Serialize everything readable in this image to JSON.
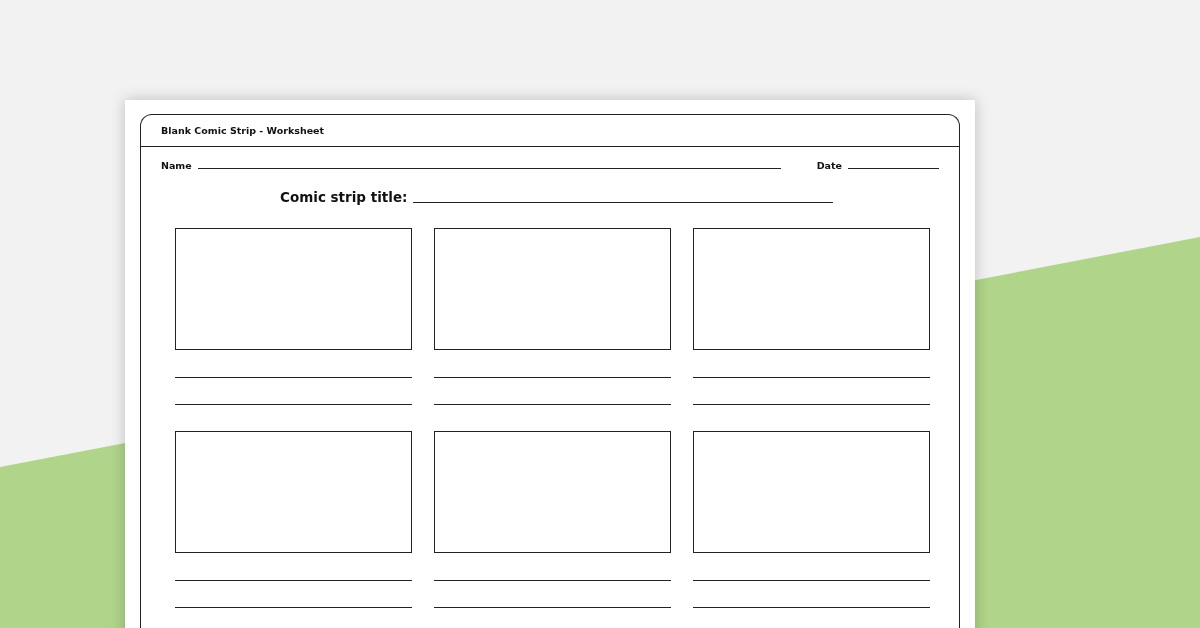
{
  "worksheet": {
    "title": "Blank Comic Strip - Worksheet",
    "name_label": "Name",
    "date_label": "Date",
    "strip_title_label": "Comic strip title:"
  },
  "panels": [
    {
      "kind": "frame-with-lines"
    },
    {
      "kind": "frame-with-lines"
    },
    {
      "kind": "frame-with-lines"
    },
    {
      "kind": "frame-with-lines"
    },
    {
      "kind": "frame-with-lines"
    },
    {
      "kind": "frame-with-lines"
    }
  ]
}
